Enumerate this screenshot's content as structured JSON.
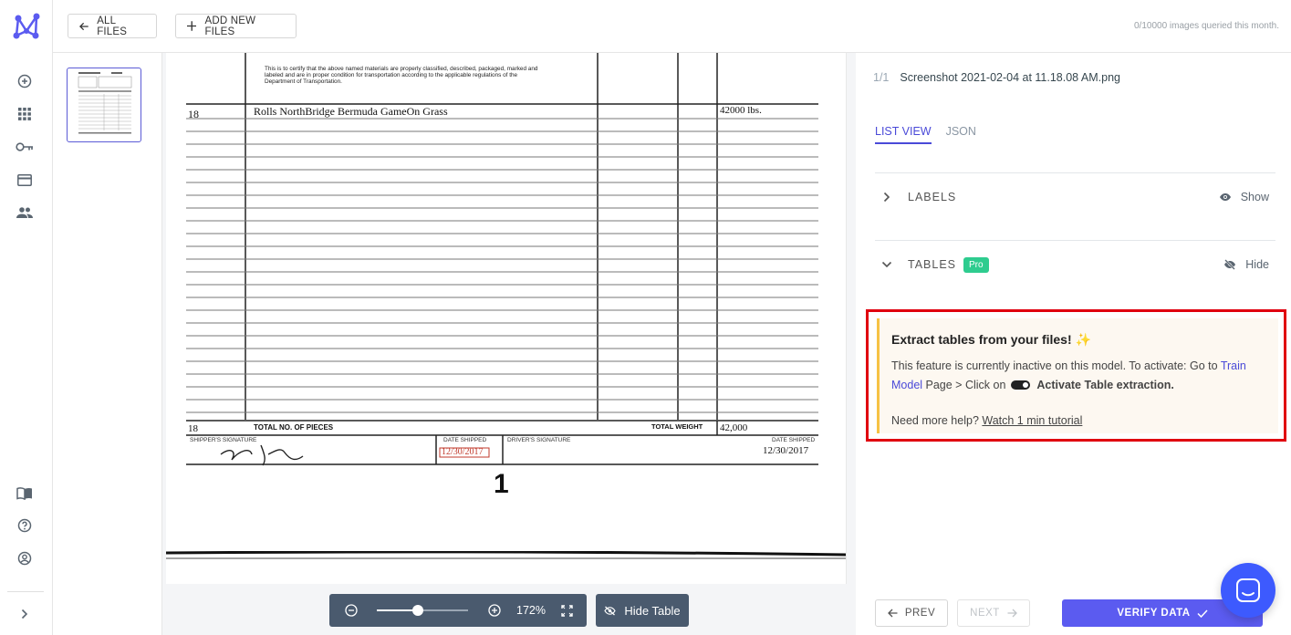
{
  "rail": {
    "icons": [
      "add-circle-icon",
      "apps-grid-icon",
      "key-icon",
      "credit-card-icon",
      "people-icon",
      "book-icon",
      "help-circle-icon",
      "account-circle-icon",
      "chevron-right-icon"
    ]
  },
  "topbar": {
    "all_files": "ALL FILES",
    "add_new_files": "ADD NEW FILES",
    "quota": "0/10000 images queried this month."
  },
  "document": {
    "certify_text_1": "This is to certify that the above named materials are properly classified, described, packaged, marked and",
    "certify_text_2": "labeled and are in proper condition for transportation according to the applicable regulations of the",
    "certify_text_3": "Department of Transportation.",
    "row_qty": "18",
    "row_desc": "Rolls NorthBridge Bermuda GameOn Grass",
    "row_weight": "42000 lbs.",
    "total_qty": "18",
    "total_pieces_label": "TOTAL NO. OF PIECES",
    "total_weight_label": "TOTAL WEIGHT",
    "total_weight": "42,000",
    "shipper_sig_label": "SHIPPER'S SIGNATURE",
    "date_shipped_label": "DATE SHIPPED",
    "date_shipped": "12/30/2017",
    "driver_sig_label": "DRIVER'S SIGNATURE",
    "date_shipped_label_2": "DATE SHIPPED",
    "date_shipped_2": "12/30/2017",
    "page_number": "1"
  },
  "viewer": {
    "zoom_level": 0.45,
    "zoom_percent": "172%",
    "hide_table": "Hide Table"
  },
  "panel": {
    "file_count": "1/1",
    "file_name": "Screenshot 2021-02-04 at 11.18.08 AM.png",
    "tab_list": "LIST VIEW",
    "tab_json": "JSON",
    "labels_title": "LABELS",
    "labels_action": "Show",
    "tables_title": "TABLES",
    "pro_badge": "Pro",
    "tables_action": "Hide",
    "callout": {
      "title": "Extract tables from your files! ✨",
      "body_1": "This feature is currently inactive on this model. To activate: Go to ",
      "link_train": "Train Model",
      "body_2": " Page > Click on ",
      "activate": "Activate Table extraction.",
      "help_q": "Need more help? ",
      "help_link": "Watch 1 min tutorial"
    },
    "prev": "PREV",
    "next": "NEXT",
    "verify": "VERIFY DATA"
  },
  "colors": {
    "accent": "#5b5bf0",
    "pro_badge": "#2ecc8f",
    "callout_border": "#f6c244",
    "highlight_box": "#e0000f"
  }
}
